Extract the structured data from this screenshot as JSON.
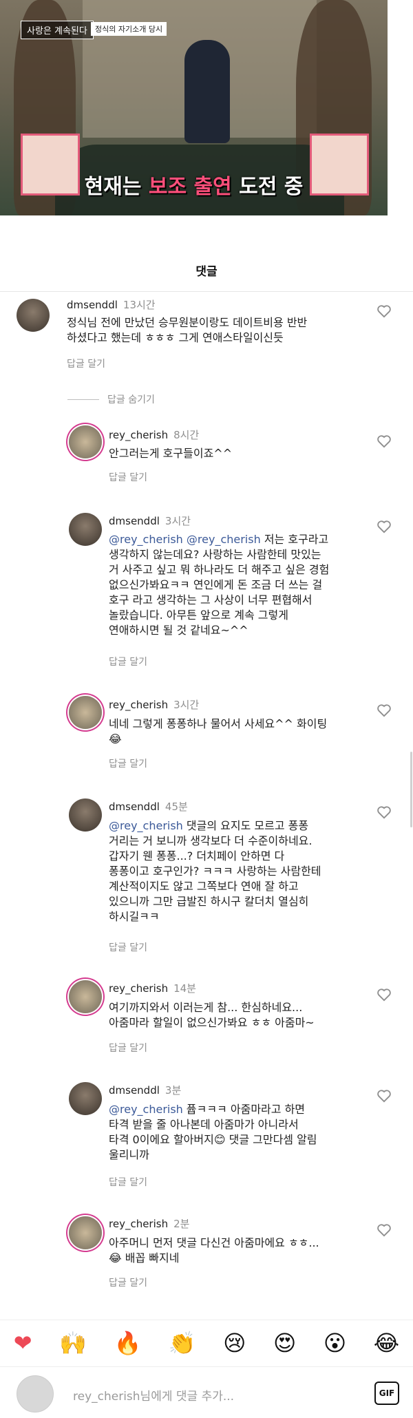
{
  "hero": {
    "show_title": "사랑은 계속된다",
    "episode_tag": "정식의 자기소개 당시",
    "subtitle_pre": "현재는 ",
    "subtitle_highlight": "보조 출연",
    "subtitle_post": " 도전 중"
  },
  "header": {
    "title": "댓글"
  },
  "reply_label": "답글 달기",
  "hide_replies": "답글 숨기기",
  "comments": [
    {
      "user": "dmsenddl",
      "time": "13시간",
      "mention": "",
      "text": "정식님 전에 만났던 승무원분이랑도 데이트비용 반반\n하셨다고 했는데 ㅎㅎㅎ 그게 연애스타일이신듯"
    },
    {
      "user": "rey_cherish",
      "time": "8시간",
      "mention": "",
      "text": "안그러는게 호구들이죠^^"
    },
    {
      "user": "dmsenddl",
      "time": "3시간",
      "mention": "@rey_cherish @rey_cherish",
      "text": " 저는 호구라고\n생각하지 않는데요? 사랑하는 사람한테 맛있는\n거 사주고 싶고 뭐 하나라도 더 해주고 싶은 경험\n없으신가봐요ㅋㅋ 연인에게 돈 조금 더 쓰는 걸\n호구 라고 생각하는 그 사상이 너무 편협해서\n놀랐습니다. 아무튼 앞으로 계속 그렇게\n연애하시면 될 것 같네요~^^"
    },
    {
      "user": "rey_cherish",
      "time": "3시간",
      "mention": "",
      "text": "네네 그렇게 퐁퐁하나 물어서 사세요^^ 화이팅\n😂"
    },
    {
      "user": "dmsenddl",
      "time": "45분",
      "mention": "@rey_cherish",
      "text": " 댓글의 요지도 모르고 퐁퐁\n거리는 거 보니까 생각보다 더 수준이하네요.\n갑자기 웬 퐁퐁...? 더치페이 안하면 다\n퐁퐁이고 호구인가? ㅋㅋㅋ 사랑하는 사람한테\n계산적이지도 않고 그쪽보다 연애 잘 하고\n있으니까 그만 급발진 하시구 칼더치 열심히\n하시길ㅋㅋ"
    },
    {
      "user": "rey_cherish",
      "time": "14분",
      "mention": "",
      "text": "여기까지와서 이러는게 참... 한심하네요...\n아줌마라 할일이 없으신가봐요 ㅎㅎ 아줌마~"
    },
    {
      "user": "dmsenddl",
      "time": "3분",
      "mention": "@rey_cherish",
      "text": " 퓹ㅋㅋㅋ 아줌마라고 하면\n타격 받을 줄 아나본데 아줌마가 아니라서\n타격 0이에요 할아버지😊 댓글 그만다셈 알림\n울리니까"
    },
    {
      "user": "rey_cherish",
      "time": "2분",
      "mention": "",
      "text": "아주머니 먼저 댓글 다신건 아줌마에요 ㅎㅎ...\n😂 배꼽 빠지네"
    }
  ],
  "emoji_bar": [
    "❤",
    "🙌",
    "🔥",
    "👏",
    "😢",
    "😍",
    "😮",
    "😂"
  ],
  "input": {
    "placeholder": "rey_cherish님에게 댓글 추가...",
    "gif_label": "GIF"
  },
  "colors": {
    "mention": "#3b5998",
    "muted": "#8e8e8e",
    "heart": "#ed4956",
    "ring": "#d43b8f"
  }
}
